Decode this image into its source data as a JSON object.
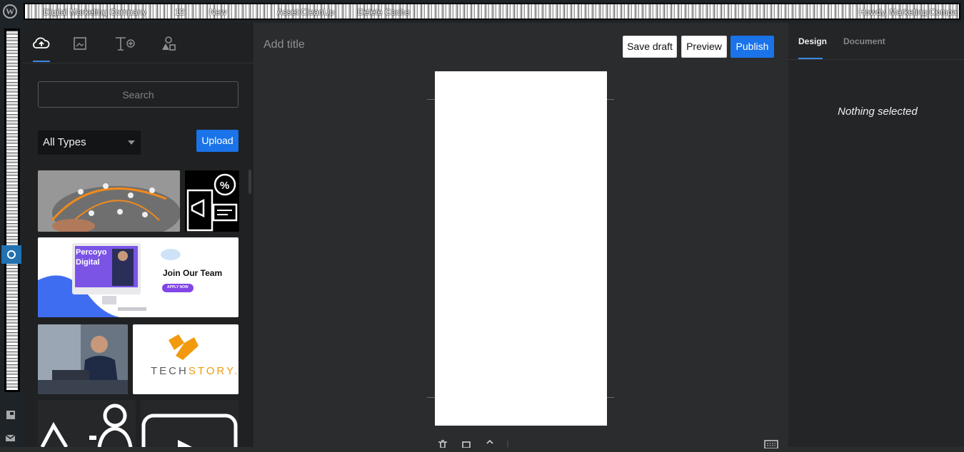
{
  "admin_bar": {
    "site_name": "Digital Marketing Company",
    "updates_count": "12",
    "new_label": "New",
    "cleanup_label": "Asset CleanUp",
    "cache_label": "Delete Cache",
    "howdy_label": "Howdy, Marketing Compa"
  },
  "library": {
    "tabs": [
      {
        "name": "upload",
        "icon": "cloud-upload-icon"
      },
      {
        "name": "media",
        "icon": "image-icon"
      },
      {
        "name": "text",
        "icon": "text-add-icon"
      },
      {
        "name": "shapes",
        "icon": "shapes-icon"
      }
    ],
    "search_placeholder": "Search",
    "type_filter": "All Types",
    "upload_label": "Upload",
    "thumbnails": {
      "join_brand": "Percoyo Digital",
      "join_title": "Join Our Team",
      "join_button": "APPLY NOW",
      "techstory_a": "TECH",
      "techstory_b": "STORY",
      "techstory_dot": "."
    }
  },
  "editor": {
    "title_placeholder": "Add title",
    "save_draft_label": "Save draft",
    "preview_label": "Preview",
    "publish_label": "Publish"
  },
  "sidebar": {
    "design_tab": "Design",
    "document_tab": "Document",
    "empty_state": "Nothing selected"
  },
  "colors": {
    "accent": "#1a73e8",
    "panel_dark": "#202122",
    "canvas_bg": "#2b2c2e",
    "admin_bar": "#1d2327"
  }
}
